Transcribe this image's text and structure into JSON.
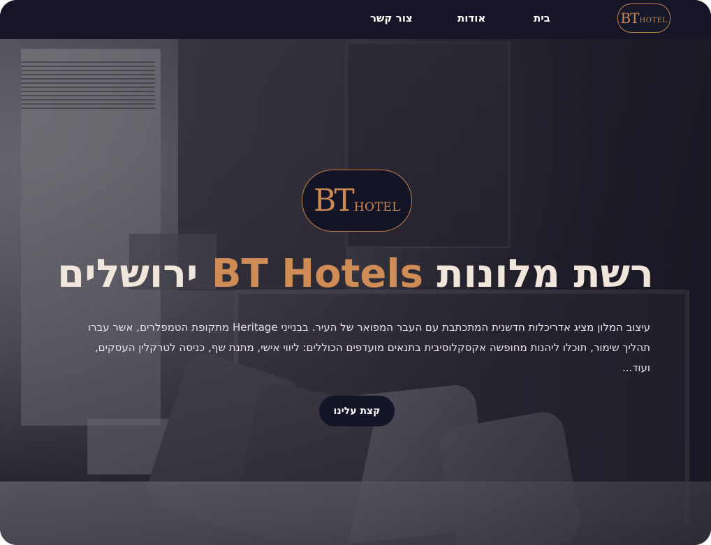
{
  "nav": {
    "logo": {
      "bt": "BT",
      "hotel": "HOTEL"
    },
    "links": [
      {
        "label": "בית"
      },
      {
        "label": "אודות"
      },
      {
        "label": "צור קשר"
      }
    ]
  },
  "hero": {
    "logo": {
      "bt": "BT",
      "hotel": "HOTEL"
    },
    "title_prefix": "רשת מלונות",
    "title_accent": "BT Hotels",
    "title_suffix": "ירושלים",
    "description": "עיצוב המלון מציג אדריכלות חדשנית המתכתבת עם העבר המפואר של העיר. בבנייני Heritage מתקופת הטמפלרים, אשר עברו תהליך שימור, תוכלו ליהנות מחופשה אקסקלוסיבית בתנאים מועדפים הכוללים: ליווי אישי, מתנת שף, כניסה לטרקלין העסקים, ועוד...",
    "cta_label": "קצת עלינו"
  },
  "colors": {
    "navbar_bg": "#151527",
    "accent": "#d08c57",
    "title": "#f0e6dc",
    "button_bg": "#141427"
  }
}
